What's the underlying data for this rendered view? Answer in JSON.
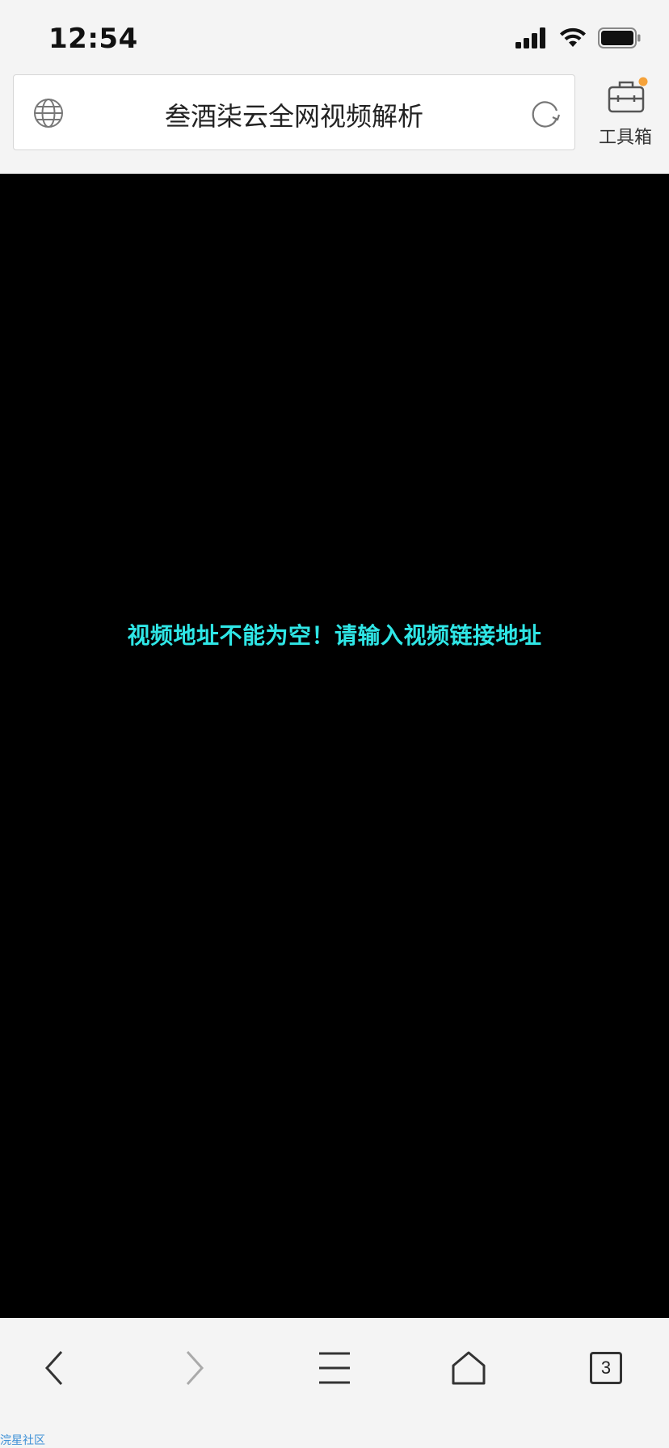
{
  "status_bar": {
    "time": "12:54",
    "icons": [
      "cellular-signal-icon",
      "wifi-icon",
      "battery-icon"
    ]
  },
  "header": {
    "title": "叁酒柒云全网视频解析",
    "toolbox_label": "工具箱",
    "icons": [
      "globe-icon",
      "reload-icon",
      "toolbox-icon"
    ],
    "badge_color": "#f5a23a"
  },
  "webview": {
    "background": "#000000",
    "message": "视频地址不能为空！请输入视频链接地址",
    "message_color": "#2fe6e6"
  },
  "bottom_nav": {
    "tab_count": "3",
    "icons": [
      "back-arrow-icon",
      "forward-arrow-icon",
      "menu-icon",
      "home-icon",
      "tabs-icon"
    ]
  },
  "footer": {
    "link_text": "浣星社区"
  }
}
